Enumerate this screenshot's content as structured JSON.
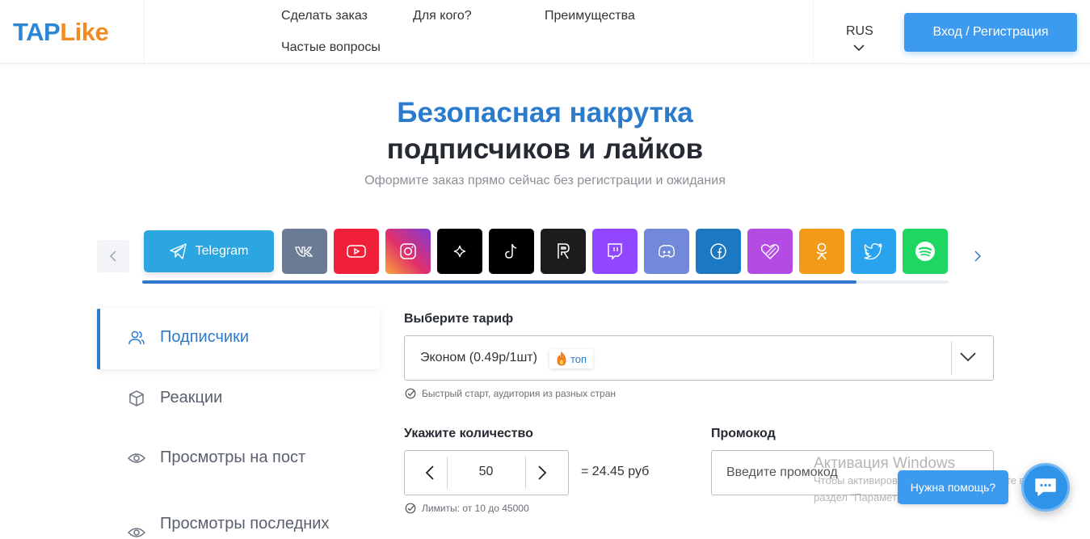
{
  "header": {
    "logo_tap": "TAP",
    "logo_like": "Like",
    "nav": [
      "Сделать заказ",
      "Для кого?",
      "Преимущества",
      "Частые вопросы"
    ],
    "lang": "RUS",
    "login": "Вход / Регистрация"
  },
  "hero": {
    "title_line1": "Безопасная накрутка",
    "title_line2": "подписчиков и лайков",
    "subtitle": "Оформите заказ прямо сейчас без регистрации и ожидания"
  },
  "platforms": {
    "active_label": "Telegram",
    "tiles": [
      {
        "icon": "vk-icon",
        "color": "#6c7b95"
      },
      {
        "icon": "youtube-icon",
        "color": "#f0203a"
      },
      {
        "icon": "instagram-icon",
        "color": "#c13584"
      },
      {
        "icon": "threads-sparkle-icon",
        "color": "#000000"
      },
      {
        "icon": "tiktok-icon",
        "color": "#000000"
      },
      {
        "icon": "rutube-icon",
        "color": "#1c1c1c"
      },
      {
        "icon": "twitch-icon",
        "color": "#9146ff"
      },
      {
        "icon": "discord-icon",
        "color": "#7289da"
      },
      {
        "icon": "facebook-icon",
        "color": "#1a79c2"
      },
      {
        "icon": "likee-icon",
        "color": "#b44be3"
      },
      {
        "icon": "odnoklassniki-icon",
        "color": "#f39a1b"
      },
      {
        "icon": "twitter-icon",
        "color": "#2aa3ef"
      },
      {
        "icon": "spotify-icon",
        "color": "#1ed760"
      }
    ],
    "scroll_fraction": 0.886
  },
  "sidebar": {
    "items": [
      {
        "label": "Подписчики",
        "icon": "users-icon",
        "active": true
      },
      {
        "label": "Реакции",
        "icon": "cube-icon",
        "active": false
      },
      {
        "label": "Просмотры на пост",
        "icon": "eye-icon",
        "active": false
      },
      {
        "label": "Просмотры последних",
        "icon": "eye-icon",
        "active": false
      }
    ]
  },
  "form": {
    "tariff_label": "Выберите тариф",
    "tariff_value": "Эконом (0.49р/1шт)",
    "tariff_badge": "топ",
    "tariff_hint": "Быстрый старт, аудитория из разных стран",
    "qty_label": "Укажите количество",
    "qty_value": "50",
    "qty_total": "= 24.45 руб",
    "qty_hint": "Лимиты: от 10 до 45000",
    "promo_label": "Промокод",
    "promo_placeholder": "Введите промокод"
  },
  "overlay": {
    "win_line1": "Активация Windows",
    "win_line2": "Чтобы активировать Windows, перейдите в",
    "win_line3": "раздел \"Параметры\".",
    "help": "Нужна помощь?"
  },
  "colors": {
    "accent": "#2b7bcc",
    "button": "#3c9bef",
    "telegram": "#2ba6e0"
  }
}
